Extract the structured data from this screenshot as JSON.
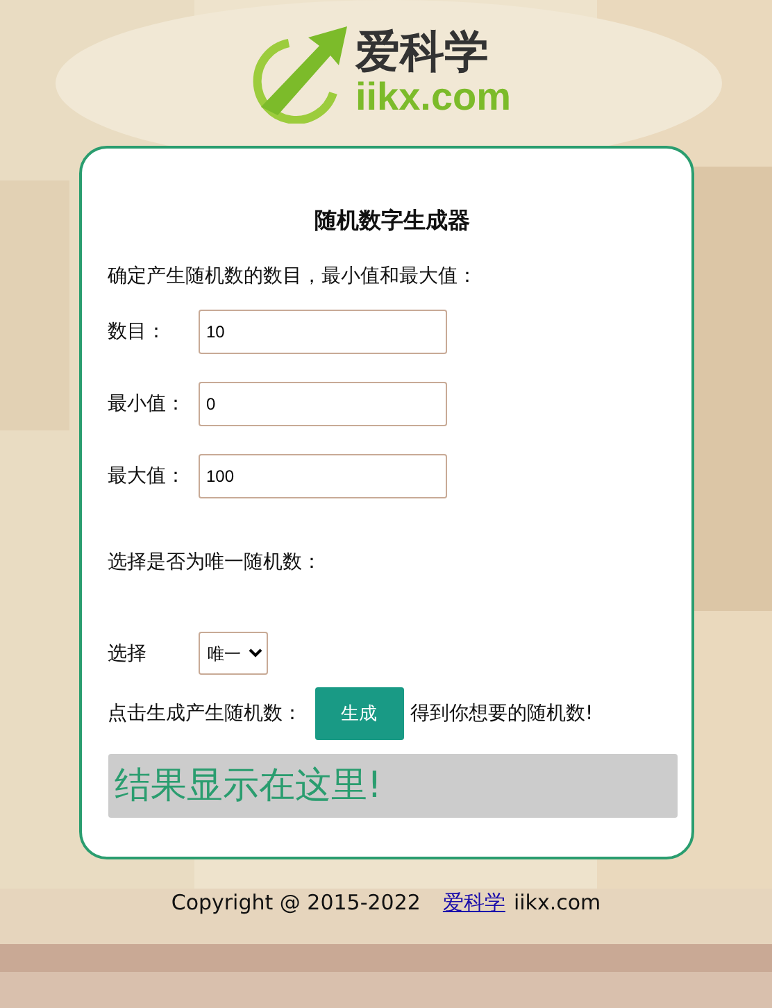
{
  "logo": {
    "title": "爱科学",
    "domain": "iikx.com"
  },
  "card": {
    "title": "随机数字生成器",
    "intro": "确定产生随机数的数目，最小值和最大值：",
    "fields": [
      {
        "label": "数目：",
        "value": "10"
      },
      {
        "label": "最小值：",
        "value": "0"
      },
      {
        "label": "最大值：",
        "value": "100"
      }
    ],
    "unique_prompt": "选择是否为唯一随机数：",
    "select": {
      "label": "选择",
      "value": "唯一"
    },
    "generate": {
      "prompt": "点击生成产生随机数：",
      "button": "生成",
      "hint": "得到你想要的随机数!"
    },
    "result": "结果显示在这里!"
  },
  "footer": {
    "copyright": "Copyright @ 2015-2022",
    "link": "爱科学",
    "site": "iikx.com"
  }
}
